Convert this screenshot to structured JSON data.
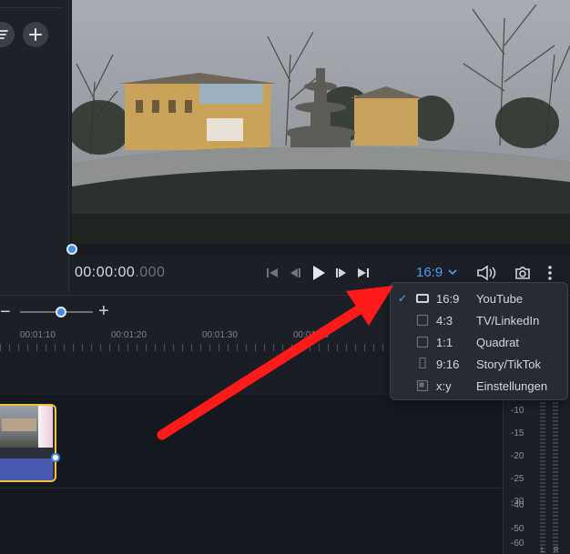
{
  "left_panel": {
    "buttons": [
      "filter-icon",
      "plus-icon"
    ]
  },
  "player": {
    "timecode_main": "00:00:00",
    "timecode_ms": ".000",
    "aspect_label": "16:9",
    "icons": [
      "skip-start-icon",
      "step-back-icon",
      "play-icon",
      "step-forward-icon",
      "skip-end-icon",
      "chevron-down-icon",
      "volume-icon",
      "camera-icon",
      "more-icon"
    ]
  },
  "aspect_menu": {
    "items": [
      {
        "ratio": "16:9",
        "name": "YouTube",
        "selected": true,
        "icon": "landscape-icon"
      },
      {
        "ratio": "4:3",
        "name": "TV/LinkedIn",
        "selected": false,
        "icon": "square-icon"
      },
      {
        "ratio": "1:1",
        "name": "Quadrat",
        "selected": false,
        "icon": "square-icon"
      },
      {
        "ratio": "9:16",
        "name": "Story/TikTok",
        "selected": false,
        "icon": "portrait-icon"
      },
      {
        "ratio": "x:y",
        "name": "Einstellungen",
        "selected": false,
        "icon": "custom-ratio-icon"
      }
    ]
  },
  "timeline": {
    "zoom_minus": "−",
    "zoom_plus": "+",
    "zoom_level": 0.55,
    "ruler": [
      "00:01:10",
      "00:01:20",
      "00:01:30",
      "00:01:40"
    ]
  },
  "meter": {
    "db_labels": [
      "-10",
      "-15",
      "-20",
      "-25",
      "-30",
      "-40",
      "-50",
      "-60"
    ],
    "channels": [
      "L",
      "R"
    ]
  },
  "colors": {
    "accent": "#4d9ef5",
    "clip_border": "#f2c230",
    "arrow": "#ff1a1a"
  }
}
